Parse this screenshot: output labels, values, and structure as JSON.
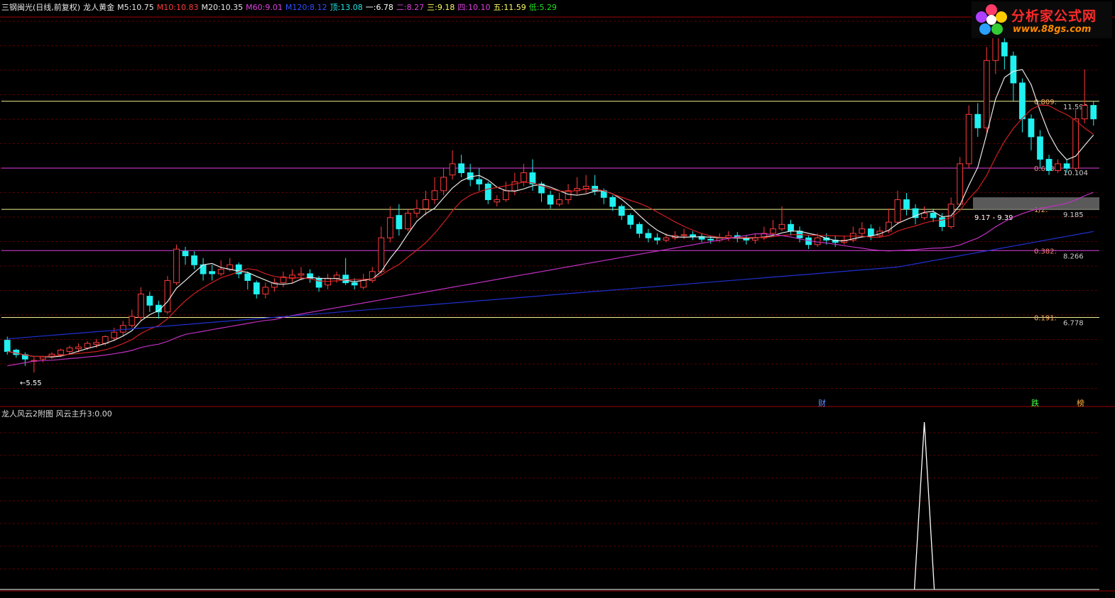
{
  "header": {
    "title": "三钢闽光(日线,前复权)",
    "indicator": "龙人黄金",
    "items": [
      {
        "label": "M5:",
        "value": "10.75",
        "color": "#e8e8e8"
      },
      {
        "label": "M10:",
        "value": "10.83",
        "color": "#ff3b3b"
      },
      {
        "label": "M20:",
        "value": "10.35",
        "color": "#e8e8e8"
      },
      {
        "label": "M60:",
        "value": "9.01",
        "color": "#e040e0"
      },
      {
        "label": "M120:",
        "value": "8.12",
        "color": "#3050ff"
      },
      {
        "label": "顶:",
        "value": "13.08",
        "color": "#20e8e8"
      },
      {
        "label": "一:",
        "value": "6.78",
        "color": "#ffffff"
      },
      {
        "label": "二:",
        "value": "8.27",
        "color": "#e040e0"
      },
      {
        "label": "三:",
        "value": "9.18",
        "color": "#ffff60"
      },
      {
        "label": "四:",
        "value": "10.10",
        "color": "#e040e0"
      },
      {
        "label": "五:",
        "value": "11.59",
        "color": "#ffff60"
      },
      {
        "label": "低:",
        "value": "5.29",
        "color": "#20e020"
      }
    ]
  },
  "logo": {
    "title": "分析家公式网",
    "url_text": "www.88gs.com"
  },
  "subpanel": {
    "title": "龙人风云2附图",
    "line_label": "风云主升3:",
    "line_value": "0.00"
  },
  "fib_levels": [
    {
      "ratio_label": "0.809:",
      "price_label": "11.592",
      "price": 11.592,
      "color": "#f0f090"
    },
    {
      "ratio_label": "0.618:",
      "price_label": "10.104",
      "price": 10.104,
      "color": "#e040e0"
    },
    {
      "ratio_label": "1/2:",
      "price_label": "9.185",
      "price": 9.185,
      "color": "#f0f090"
    },
    {
      "ratio_label": "0.382:",
      "price_label": "8.266",
      "price": 8.266,
      "color": "#e040e0"
    },
    {
      "ratio_label": "0.191:",
      "price_label": "6.778",
      "price": 6.778,
      "color": "#f0f090"
    }
  ],
  "annotations": {
    "low_label": "←5.55",
    "range_label": "9.17 - 9.39",
    "markers": [
      {
        "text": "财",
        "color": "#6090ff"
      },
      {
        "text": "跌",
        "color": "#40ff40"
      },
      {
        "text": "榜",
        "color": "#ffb040"
      }
    ]
  },
  "colors": {
    "up": "#ff3b3b",
    "down": "#20f0f0",
    "ma5": "#e8e8e8",
    "ma10": "#d02020",
    "ma60": "#c030c0",
    "ma120": "#2030d0",
    "grid": "#5a0000",
    "separator": "#a00000"
  },
  "chart_data": {
    "type": "candlestick",
    "price_range": [
      5.29,
      13.08
    ],
    "candles": [
      [
        6.27,
        6.02,
        6.35,
        5.95
      ],
      [
        6.05,
        5.95,
        6.08,
        5.88
      ],
      [
        5.95,
        5.85,
        6.0,
        5.7
      ],
      [
        5.8,
        5.82,
        5.9,
        5.55
      ],
      [
        5.85,
        5.9,
        5.92,
        5.78
      ],
      [
        5.9,
        5.96,
        6.0,
        5.85
      ],
      [
        5.95,
        6.05,
        6.08,
        5.9
      ],
      [
        6.02,
        6.1,
        6.15,
        5.95
      ],
      [
        6.08,
        6.12,
        6.2,
        6.0
      ],
      [
        6.1,
        6.2,
        6.25,
        6.05
      ],
      [
        6.18,
        6.22,
        6.3,
        6.1
      ],
      [
        6.2,
        6.35,
        6.38,
        6.15
      ],
      [
        6.32,
        6.45,
        6.55,
        6.25
      ],
      [
        6.45,
        6.6,
        6.7,
        6.38
      ],
      [
        6.6,
        6.8,
        6.95,
        6.55
      ],
      [
        6.78,
        7.3,
        7.45,
        6.7
      ],
      [
        7.25,
        7.05,
        7.35,
        6.9
      ],
      [
        7.05,
        6.9,
        7.15,
        6.75
      ],
      [
        6.9,
        7.6,
        7.7,
        6.85
      ],
      [
        7.55,
        8.3,
        8.4,
        7.5
      ],
      [
        8.25,
        8.15,
        8.35,
        7.95
      ],
      [
        8.15,
        7.95,
        8.25,
        7.85
      ],
      [
        7.95,
        7.75,
        8.1,
        7.6
      ],
      [
        7.8,
        7.75,
        7.95,
        7.6
      ],
      [
        7.75,
        7.85,
        8.05,
        7.7
      ],
      [
        7.85,
        7.95,
        8.1,
        7.8
      ],
      [
        7.95,
        7.75,
        8.0,
        7.65
      ],
      [
        7.75,
        7.6,
        7.8,
        7.4
      ],
      [
        7.55,
        7.3,
        7.6,
        7.2
      ],
      [
        7.3,
        7.45,
        7.55,
        7.2
      ],
      [
        7.45,
        7.55,
        7.65,
        7.35
      ],
      [
        7.55,
        7.68,
        7.8,
        7.45
      ],
      [
        7.65,
        7.72,
        7.85,
        7.55
      ],
      [
        7.72,
        7.75,
        7.9,
        7.6
      ],
      [
        7.75,
        7.65,
        7.85,
        7.55
      ],
      [
        7.65,
        7.45,
        7.7,
        7.35
      ],
      [
        7.5,
        7.65,
        7.75,
        7.4
      ],
      [
        7.65,
        7.72,
        7.8,
        7.55
      ],
      [
        7.72,
        7.55,
        8.1,
        7.5
      ],
      [
        7.55,
        7.5,
        7.65,
        7.4
      ],
      [
        7.45,
        7.6,
        7.75,
        7.4
      ],
      [
        7.6,
        7.8,
        7.9,
        7.55
      ],
      [
        7.8,
        8.55,
        8.8,
        7.75
      ],
      [
        8.55,
        9.0,
        9.25,
        8.45
      ],
      [
        9.05,
        8.75,
        9.3,
        8.6
      ],
      [
        8.75,
        9.1,
        9.2,
        8.7
      ],
      [
        9.1,
        9.2,
        9.4,
        9.0
      ],
      [
        9.2,
        9.4,
        9.6,
        9.05
      ],
      [
        9.4,
        9.6,
        9.9,
        9.3
      ],
      [
        9.6,
        9.9,
        10.1,
        9.5
      ],
      [
        9.95,
        10.2,
        10.5,
        9.85
      ],
      [
        10.2,
        10.0,
        10.4,
        9.9
      ],
      [
        10.0,
        9.85,
        10.2,
        9.7
      ],
      [
        9.85,
        9.75,
        10.1,
        9.6
      ],
      [
        9.75,
        9.4,
        9.8,
        9.3
      ],
      [
        9.35,
        9.4,
        9.5,
        9.25
      ],
      [
        9.4,
        9.6,
        9.8,
        9.35
      ],
      [
        9.6,
        9.8,
        10.0,
        9.5
      ],
      [
        9.8,
        10.0,
        10.2,
        9.7
      ],
      [
        10.0,
        9.75,
        10.3,
        9.6
      ],
      [
        9.75,
        9.55,
        9.8,
        9.35
      ],
      [
        9.5,
        9.3,
        9.6,
        9.2
      ],
      [
        9.3,
        9.4,
        9.55,
        9.25
      ],
      [
        9.4,
        9.6,
        9.75,
        9.3
      ],
      [
        9.6,
        9.65,
        9.9,
        9.5
      ],
      [
        9.65,
        9.7,
        9.95,
        9.55
      ],
      [
        9.7,
        9.6,
        9.95,
        9.5
      ],
      [
        9.6,
        9.45,
        9.65,
        9.3
      ],
      [
        9.45,
        9.25,
        9.5,
        9.15
      ],
      [
        9.25,
        9.05,
        9.3,
        8.95
      ],
      [
        9.05,
        8.85,
        9.1,
        8.75
      ],
      [
        8.85,
        8.65,
        8.9,
        8.55
      ],
      [
        8.65,
        8.55,
        8.75,
        8.45
      ],
      [
        8.55,
        8.5,
        8.65,
        8.4
      ],
      [
        8.5,
        8.55,
        8.65,
        8.45
      ],
      [
        8.55,
        8.6,
        8.7,
        8.5
      ],
      [
        8.6,
        8.62,
        8.75,
        8.52
      ],
      [
        8.62,
        8.58,
        8.7,
        8.5
      ],
      [
        8.58,
        8.52,
        8.65,
        8.45
      ],
      [
        8.52,
        8.5,
        8.6,
        8.42
      ],
      [
        8.5,
        8.55,
        8.65,
        8.45
      ],
      [
        8.55,
        8.6,
        8.7,
        8.48
      ],
      [
        8.6,
        8.55,
        8.68,
        8.45
      ],
      [
        8.55,
        8.5,
        8.6,
        8.4
      ],
      [
        8.5,
        8.55,
        8.65,
        8.42
      ],
      [
        8.55,
        8.65,
        8.8,
        8.5
      ],
      [
        8.65,
        8.75,
        8.95,
        8.6
      ],
      [
        8.75,
        8.85,
        9.25,
        8.7
      ],
      [
        8.85,
        8.7,
        8.95,
        8.6
      ],
      [
        8.7,
        8.55,
        8.8,
        8.45
      ],
      [
        8.55,
        8.4,
        8.6,
        8.3
      ],
      [
        8.4,
        8.55,
        8.65,
        8.35
      ],
      [
        8.55,
        8.5,
        8.65,
        8.4
      ],
      [
        8.5,
        8.45,
        8.6,
        8.35
      ],
      [
        8.45,
        8.5,
        8.6,
        8.4
      ],
      [
        8.5,
        8.65,
        8.8,
        8.45
      ],
      [
        8.65,
        8.75,
        8.9,
        8.6
      ],
      [
        8.75,
        8.6,
        8.85,
        8.5
      ],
      [
        8.6,
        8.7,
        8.8,
        8.55
      ],
      [
        8.7,
        8.9,
        9.2,
        8.65
      ],
      [
        8.9,
        9.4,
        9.6,
        8.85
      ],
      [
        9.4,
        9.2,
        9.55,
        9.05
      ],
      [
        9.2,
        9.0,
        9.3,
        8.85
      ],
      [
        9.0,
        9.1,
        9.25,
        8.95
      ],
      [
        9.1,
        9.0,
        9.2,
        8.9
      ],
      [
        9.0,
        8.8,
        9.1,
        8.7
      ],
      [
        8.8,
        9.3,
        9.45,
        8.75
      ],
      [
        9.3,
        10.2,
        10.35,
        9.25
      ],
      [
        10.2,
        11.3,
        11.5,
        10.1
      ],
      [
        11.3,
        11.0,
        11.55,
        10.8
      ],
      [
        11.0,
        12.5,
        12.8,
        10.9
      ],
      [
        12.5,
        13.2,
        13.5,
        12.2
      ],
      [
        12.9,
        12.6,
        13.08,
        12.3
      ],
      [
        12.6,
        12.0,
        12.7,
        11.6
      ],
      [
        12.0,
        11.2,
        12.1,
        10.9
      ],
      [
        11.2,
        10.8,
        11.3,
        10.5
      ],
      [
        10.8,
        10.3,
        10.95,
        10.1
      ],
      [
        10.3,
        10.05,
        10.4,
        9.95
      ],
      [
        10.05,
        10.2,
        10.3,
        10.0
      ],
      [
        10.2,
        10.1,
        10.3,
        10.0
      ],
      [
        10.1,
        11.2,
        11.4,
        10.05
      ],
      [
        11.2,
        11.5,
        12.3,
        11.1
      ],
      [
        11.5,
        11.2,
        11.6,
        11.05
      ]
    ],
    "subpanel_signal": {
      "spike_index": 103,
      "value_range": [
        0,
        1
      ],
      "spike_value": 1
    }
  }
}
